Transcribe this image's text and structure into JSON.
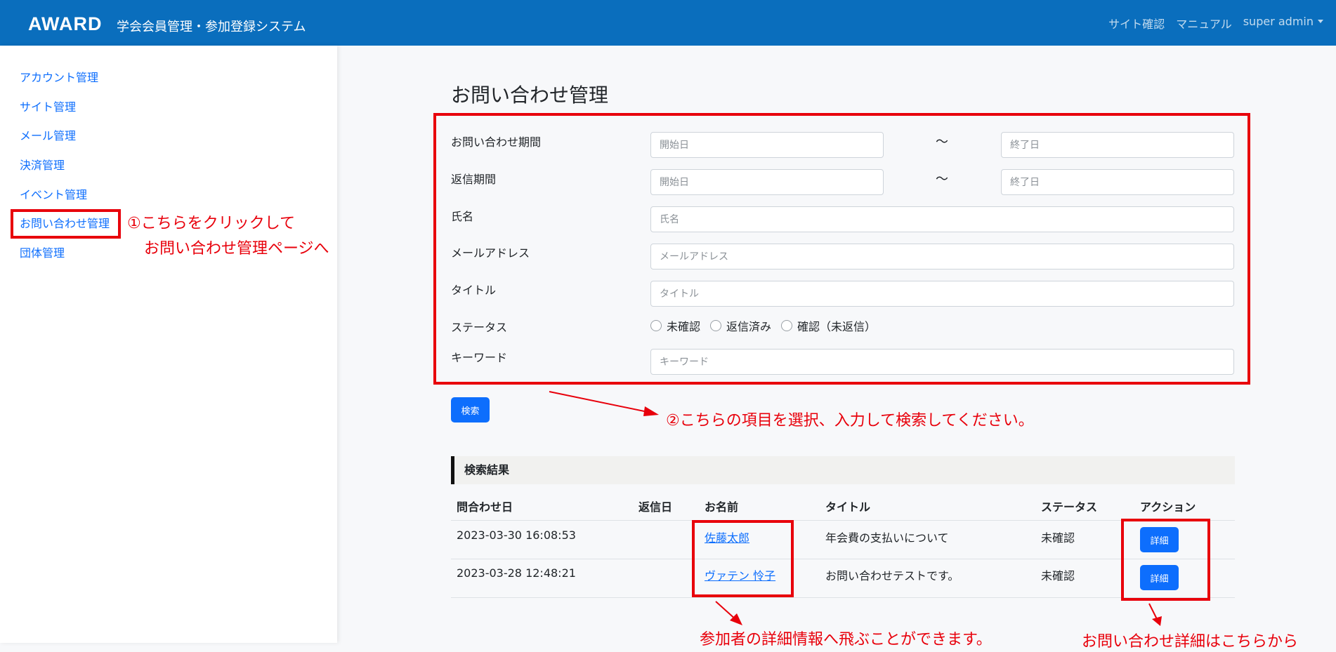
{
  "header": {
    "logo": "AWARD",
    "title": "学会会員管理・参加登録システム",
    "links": [
      "サイト確認",
      "マニュアル",
      "super admin"
    ]
  },
  "sidebar": {
    "items": [
      "アカウント管理",
      "サイト管理",
      "メール管理",
      "決済管理",
      "イベント管理",
      "お問い合わせ管理",
      "団体管理"
    ]
  },
  "page": {
    "title": "お問い合わせ管理"
  },
  "form": {
    "inquiry_period_label": "お問い合わせ期間",
    "reply_period_label": "返信期間",
    "name_label": "氏名",
    "email_label": "メールアドレス",
    "title_label": "タイトル",
    "status_label": "ステータス",
    "keyword_label": "キーワード",
    "start_placeholder": "開始日",
    "end_placeholder": "終了日",
    "name_placeholder": "氏名",
    "email_placeholder": "メールアドレス",
    "title_placeholder": "タイトル",
    "keyword_placeholder": "キーワード",
    "tilde": "〜",
    "status_options": [
      "未確認",
      "返信済み",
      "確認（未返信）"
    ],
    "search_button": "検索"
  },
  "results": {
    "heading": "検索結果",
    "columns": [
      "問合わせ日",
      "返信日",
      "お名前",
      "タイトル",
      "ステータス",
      "アクション"
    ],
    "rows": [
      {
        "date": "2023-03-30 16:08:53",
        "reply": "",
        "name": "佐藤太郎",
        "title": "年会費の支払いについて",
        "status": "未確認",
        "action": "詳細"
      },
      {
        "date": "2023-03-28 12:48:21",
        "reply": "",
        "name": "ヴァテン 怜子",
        "title": "お問い合わせテストです。",
        "status": "未確認",
        "action": "詳細"
      }
    ]
  },
  "annotations": {
    "step1_line1": "①こちらをクリックして",
    "step1_line2": "お問い合わせ管理ページへ",
    "step2": "②こちらの項目を選択、入力して検索してください。",
    "name_note": "参加者の詳細情報へ飛ぶことができます。",
    "detail_note": "お問い合わせ詳細はこちらから"
  },
  "colors": {
    "navbar": "#0a6ebd",
    "primary": "#0d6efd",
    "annotation": "#e8000b"
  }
}
